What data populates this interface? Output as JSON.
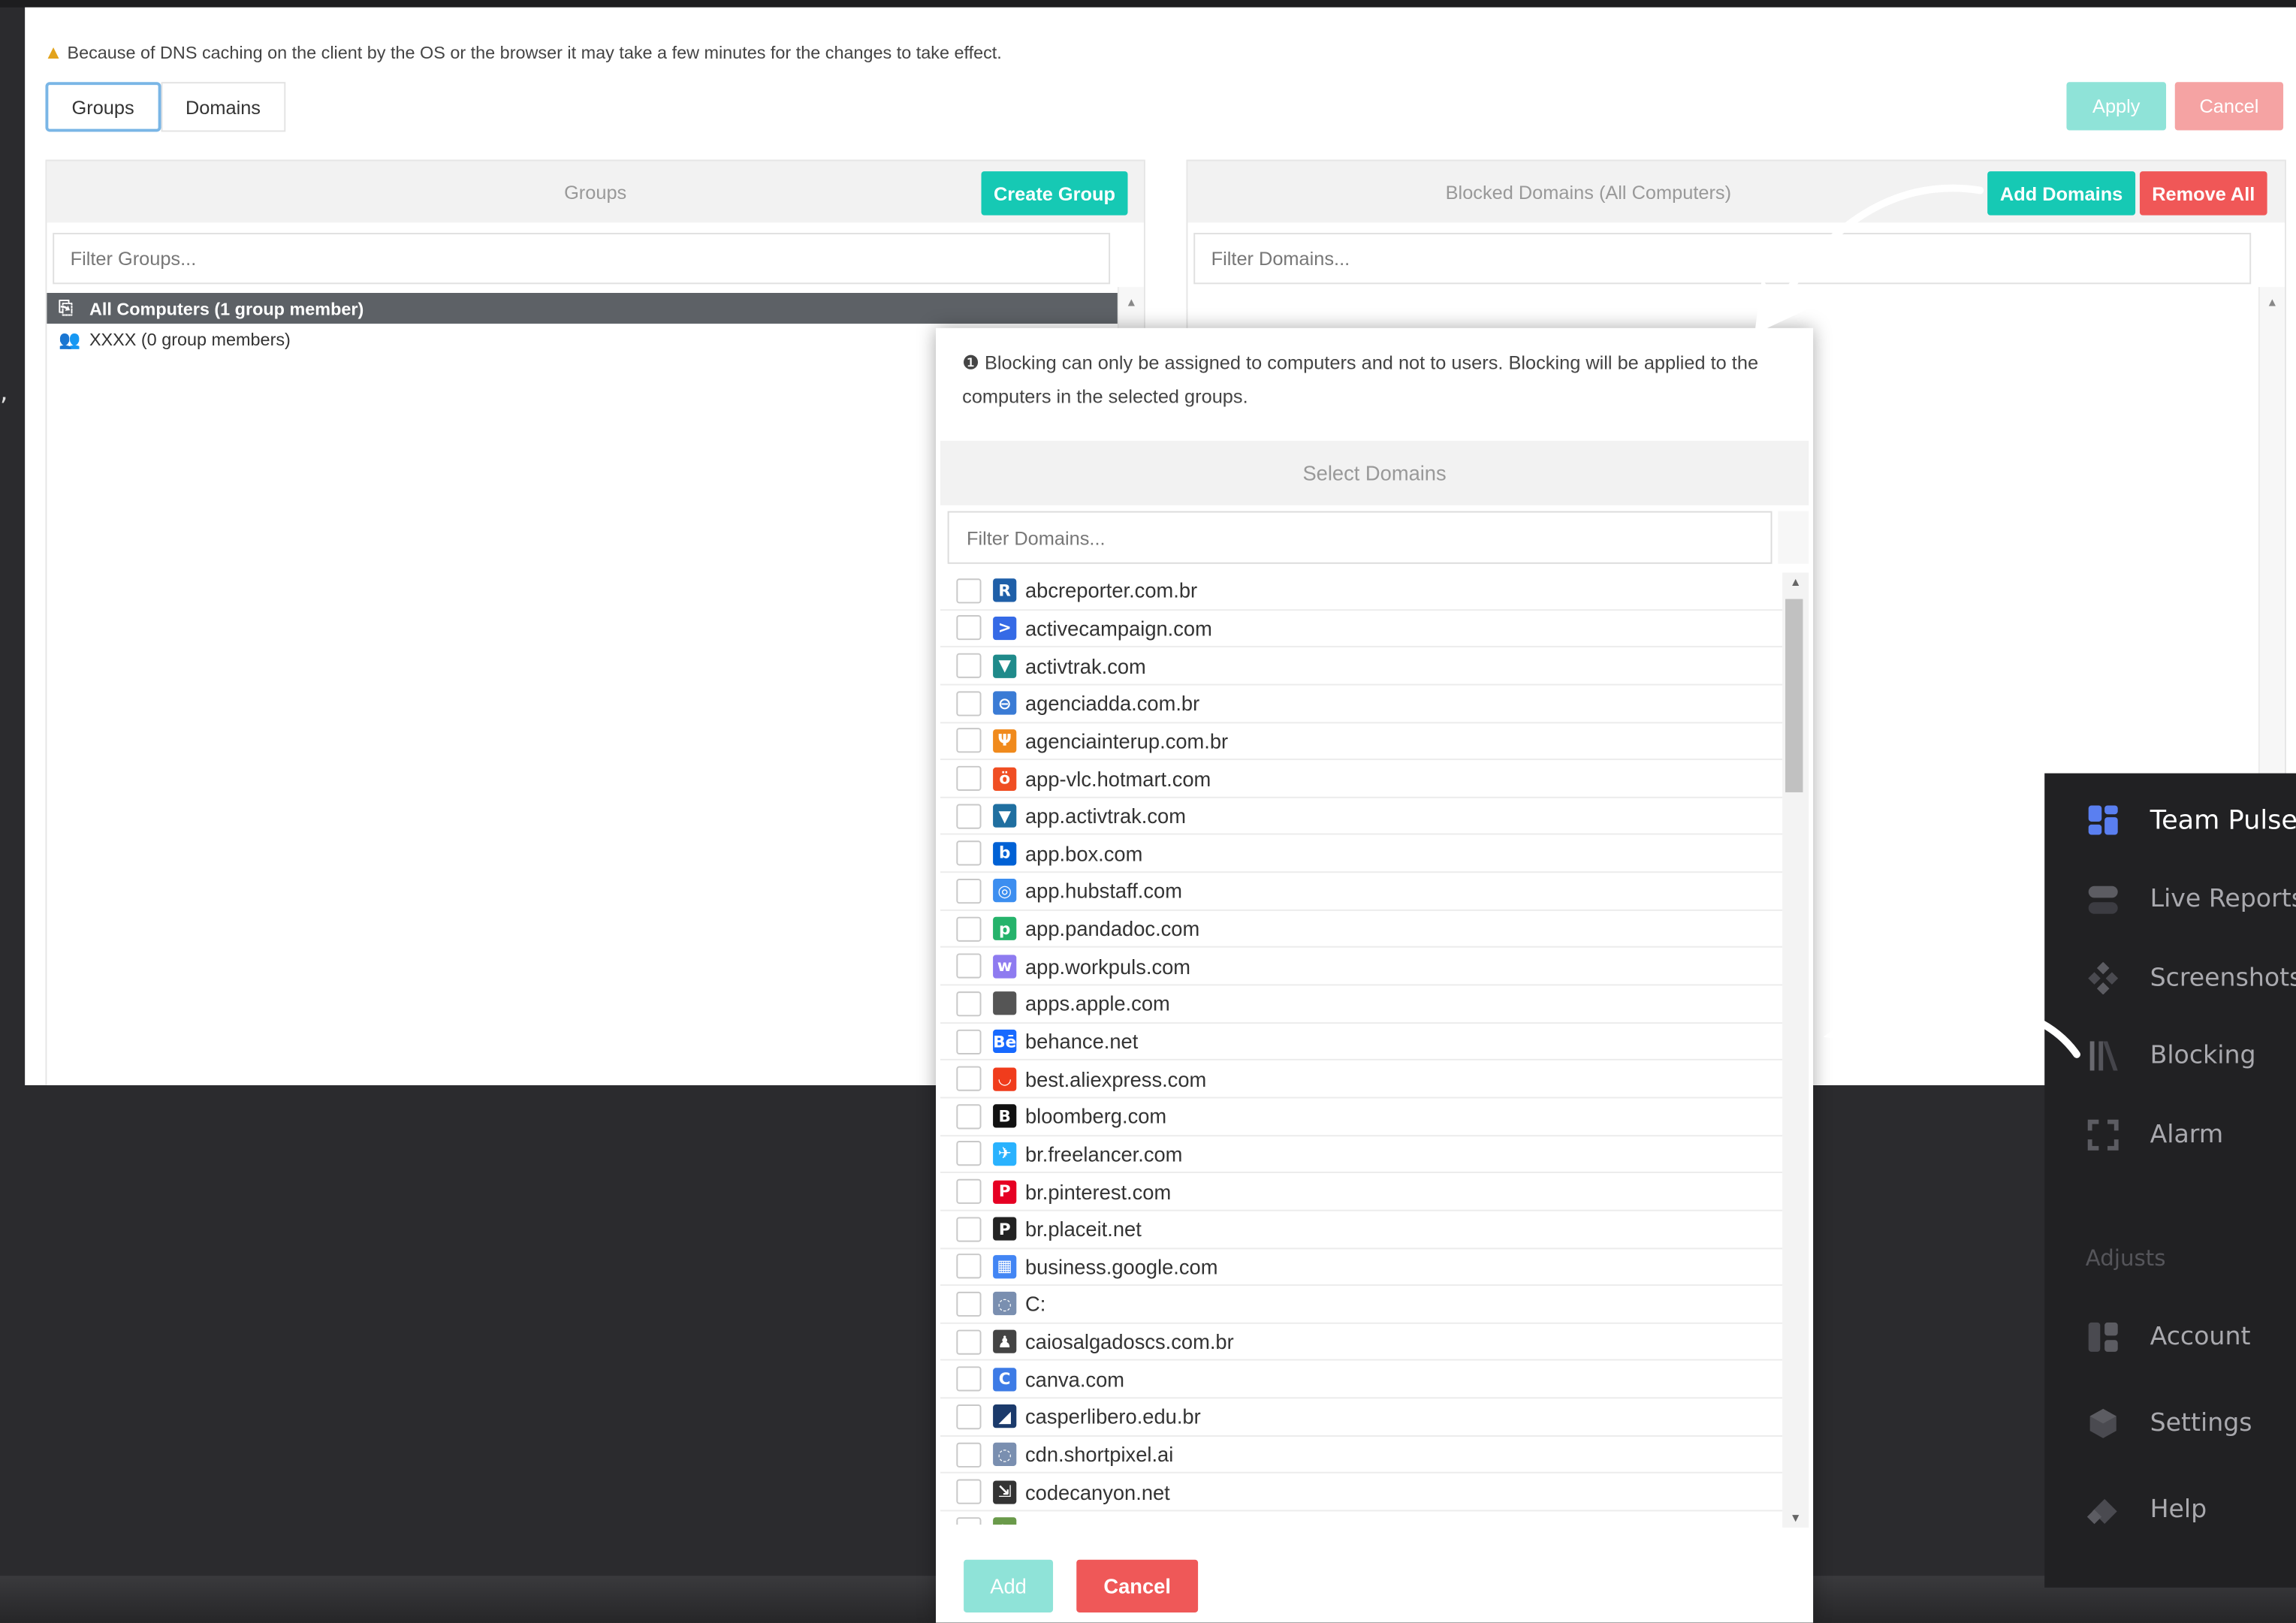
{
  "side_fragment": ",",
  "notice": {
    "icon": "warning-icon",
    "text": "Because of DNS caching on the client by the OS or the browser it may take a few minutes for the changes to take effect."
  },
  "tabs": [
    {
      "label": "Groups",
      "active": true
    },
    {
      "label": "Domains",
      "active": false
    }
  ],
  "actions": {
    "apply": "Apply",
    "cancel": "Cancel"
  },
  "groups_panel": {
    "title": "Groups",
    "create_button": "Create Group",
    "filter_placeholder": "Filter Groups...",
    "items": [
      {
        "label": "All Computers (1 group member)",
        "icon": "computers-icon",
        "selected": true
      },
      {
        "label": "XXXX (0 group members)",
        "icon": "users-icon",
        "selected": false
      }
    ]
  },
  "domains_panel": {
    "title": "Blocked Domains (All Computers)",
    "add_button": "Add Domains",
    "remove_button": "Remove All",
    "filter_placeholder": "Filter Domains..."
  },
  "modal": {
    "info_icon": "info-icon",
    "info": "Blocking can only be assigned to computers and not to users. Blocking will be applied to the computers in the selected groups.",
    "title": "Select Domains",
    "filter_placeholder": "Filter Domains...",
    "domains": [
      {
        "name": "abcreporter.com.br",
        "icon": "R",
        "color": "#1f5fa8"
      },
      {
        "name": "activecampaign.com",
        "icon": ">",
        "color": "#356ae6"
      },
      {
        "name": "activtrak.com",
        "icon": "▼",
        "color": "#1f8a8a"
      },
      {
        "name": "agenciadda.com.br",
        "icon": "⊖",
        "color": "#3a7bd5"
      },
      {
        "name": "agenciainterup.com.br",
        "icon": "Ψ",
        "color": "#f08a1c"
      },
      {
        "name": "app-vlc.hotmart.com",
        "icon": "ö",
        "color": "#f04e23"
      },
      {
        "name": "app.activtrak.com",
        "icon": "▼",
        "color": "#1f6fa0"
      },
      {
        "name": "app.box.com",
        "icon": "b",
        "color": "#0061d5"
      },
      {
        "name": "app.hubstaff.com",
        "icon": "◎",
        "color": "#3c8ef0"
      },
      {
        "name": "app.pandadoc.com",
        "icon": "p",
        "color": "#25b36b"
      },
      {
        "name": "app.workpuls.com",
        "icon": "w",
        "color": "#8e7bf0"
      },
      {
        "name": "apps.apple.com",
        "icon": "",
        "color": "#555555"
      },
      {
        "name": "behance.net",
        "icon": "Bē",
        "color": "#1769ff"
      },
      {
        "name": "best.aliexpress.com",
        "icon": "◡",
        "color": "#f03c1c"
      },
      {
        "name": "bloomberg.com",
        "icon": "B",
        "color": "#111111"
      },
      {
        "name": "br.freelancer.com",
        "icon": "✈",
        "color": "#29b2fe"
      },
      {
        "name": "br.pinterest.com",
        "icon": "P",
        "color": "#e60023"
      },
      {
        "name": "br.placeit.net",
        "icon": "P",
        "color": "#222222"
      },
      {
        "name": "business.google.com",
        "icon": "▦",
        "color": "#4285f4"
      },
      {
        "name": "C:",
        "icon": "◌",
        "color": "#7a8fb0"
      },
      {
        "name": "caiosalgadoscs.com.br",
        "icon": "♟",
        "color": "#444444"
      },
      {
        "name": "canva.com",
        "icon": "C",
        "color": "#3d7be6"
      },
      {
        "name": "casperlibero.edu.br",
        "icon": "◢",
        "color": "#1b3a6b"
      },
      {
        "name": "cdn.shortpixel.ai",
        "icon": "◌",
        "color": "#7a8fb0"
      },
      {
        "name": "codecanyon.net",
        "icon": "⇲",
        "color": "#333333"
      },
      {
        "name": "",
        "icon": "◗",
        "color": "#6a9a4a"
      }
    ],
    "add_button": "Add",
    "cancel_button": "Cancel"
  },
  "sidebar": {
    "items": [
      {
        "label": "Team Pulse",
        "icon": "dashboard-icon",
        "active": true
      },
      {
        "label": "Live Reports",
        "icon": "toggle-icon",
        "active": false
      },
      {
        "label": "Screenshots",
        "icon": "screenshots-icon",
        "active": false
      },
      {
        "label": "Blocking",
        "icon": "blocking-icon",
        "active": false
      },
      {
        "label": "Alarm",
        "icon": "alarm-icon",
        "active": false
      }
    ],
    "section_label": "Adjusts",
    "section_items": [
      {
        "label": "Account",
        "icon": "account-icon"
      },
      {
        "label": "Settings",
        "icon": "settings-icon"
      },
      {
        "label": "Help",
        "icon": "help-icon"
      }
    ]
  }
}
